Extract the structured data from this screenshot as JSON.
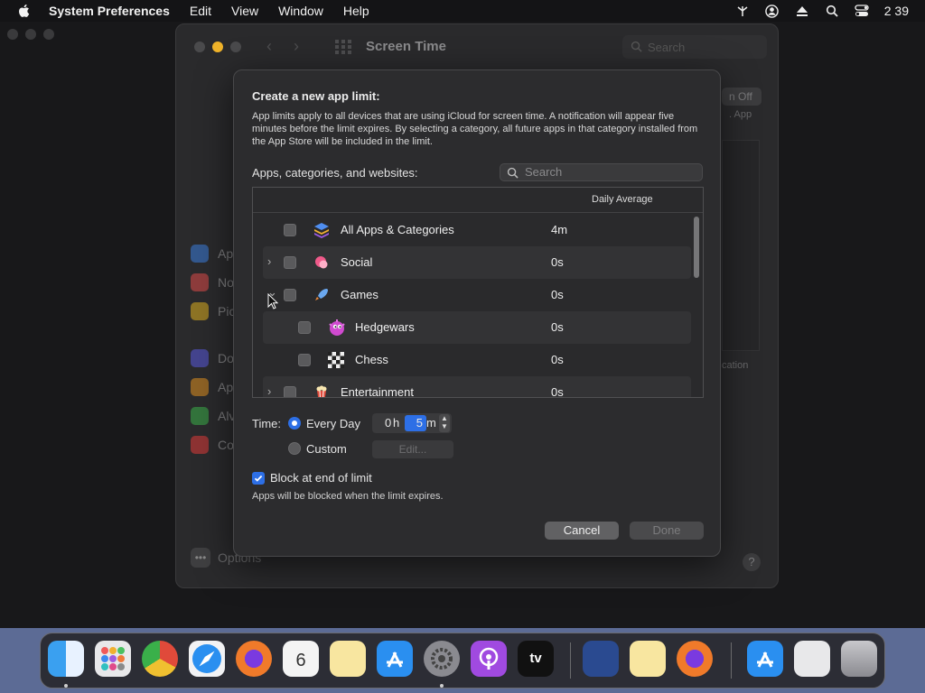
{
  "menubar": {
    "app_name": "System Preferences",
    "items": [
      "Edit",
      "View",
      "Window",
      "Help"
    ],
    "clock": "2 39"
  },
  "window": {
    "title": "Screen Time",
    "search_placeholder": "Search",
    "turn_off_label": "n Off",
    "app_label": ". App",
    "cation_label": "cation",
    "help_label": "?",
    "options_label": "Options",
    "sidebar": [
      {
        "label": "Ap",
        "color": "#3b7de0"
      },
      {
        "label": "No",
        "color": "#e04a4a"
      },
      {
        "label": "Pic",
        "color": "#e0b020"
      },
      {
        "label": "Do",
        "color": "#5a5ae0"
      },
      {
        "label": "Ap",
        "color": "#e09020"
      },
      {
        "label": "Alv",
        "color": "#3ab04a"
      },
      {
        "label": "Co",
        "color": "#e03a3a"
      }
    ]
  },
  "dialog": {
    "title": "Create a new app limit:",
    "description": "App limits apply to all devices that are using iCloud for screen time. A notification will appear five minutes before the limit expires. By selecting a category, all future apps in that category installed from the App Store will be included in the limit.",
    "apps_label": "Apps, categories, and websites:",
    "search_placeholder": "Search",
    "column_header": "Daily Average",
    "rows": [
      {
        "name": "All Apps & Categories",
        "avg": "4m",
        "chevron": "",
        "icon": "layers-icon"
      },
      {
        "name": "Social",
        "avg": "0s",
        "chevron": "›",
        "icon": "social-bubble-icon"
      },
      {
        "name": "Games",
        "avg": "0s",
        "chevron": "⌄",
        "icon": "rocket-icon"
      },
      {
        "name": "Hedgewars",
        "avg": "0s",
        "chevron": "",
        "icon": "hedgehog-icon"
      },
      {
        "name": "Chess",
        "avg": "0s",
        "chevron": "",
        "icon": "chess-board-icon"
      },
      {
        "name": "Entertainment",
        "avg": "0s",
        "chevron": "›",
        "icon": "popcorn-icon"
      }
    ],
    "time_label": "Time:",
    "every_day_label": "Every Day",
    "custom_label": "Custom",
    "hours_value": "0",
    "hours_unit": "h",
    "minutes_value": "5",
    "minutes_unit": "m",
    "edit_label": "Edit...",
    "block_label": "Block at end of limit",
    "block_note": "Apps will be blocked when the limit expires.",
    "cancel_label": "Cancel",
    "done_label": "Done"
  },
  "colors": {
    "accent": "#2d6fe6",
    "dock_background": "#5c6b95"
  }
}
